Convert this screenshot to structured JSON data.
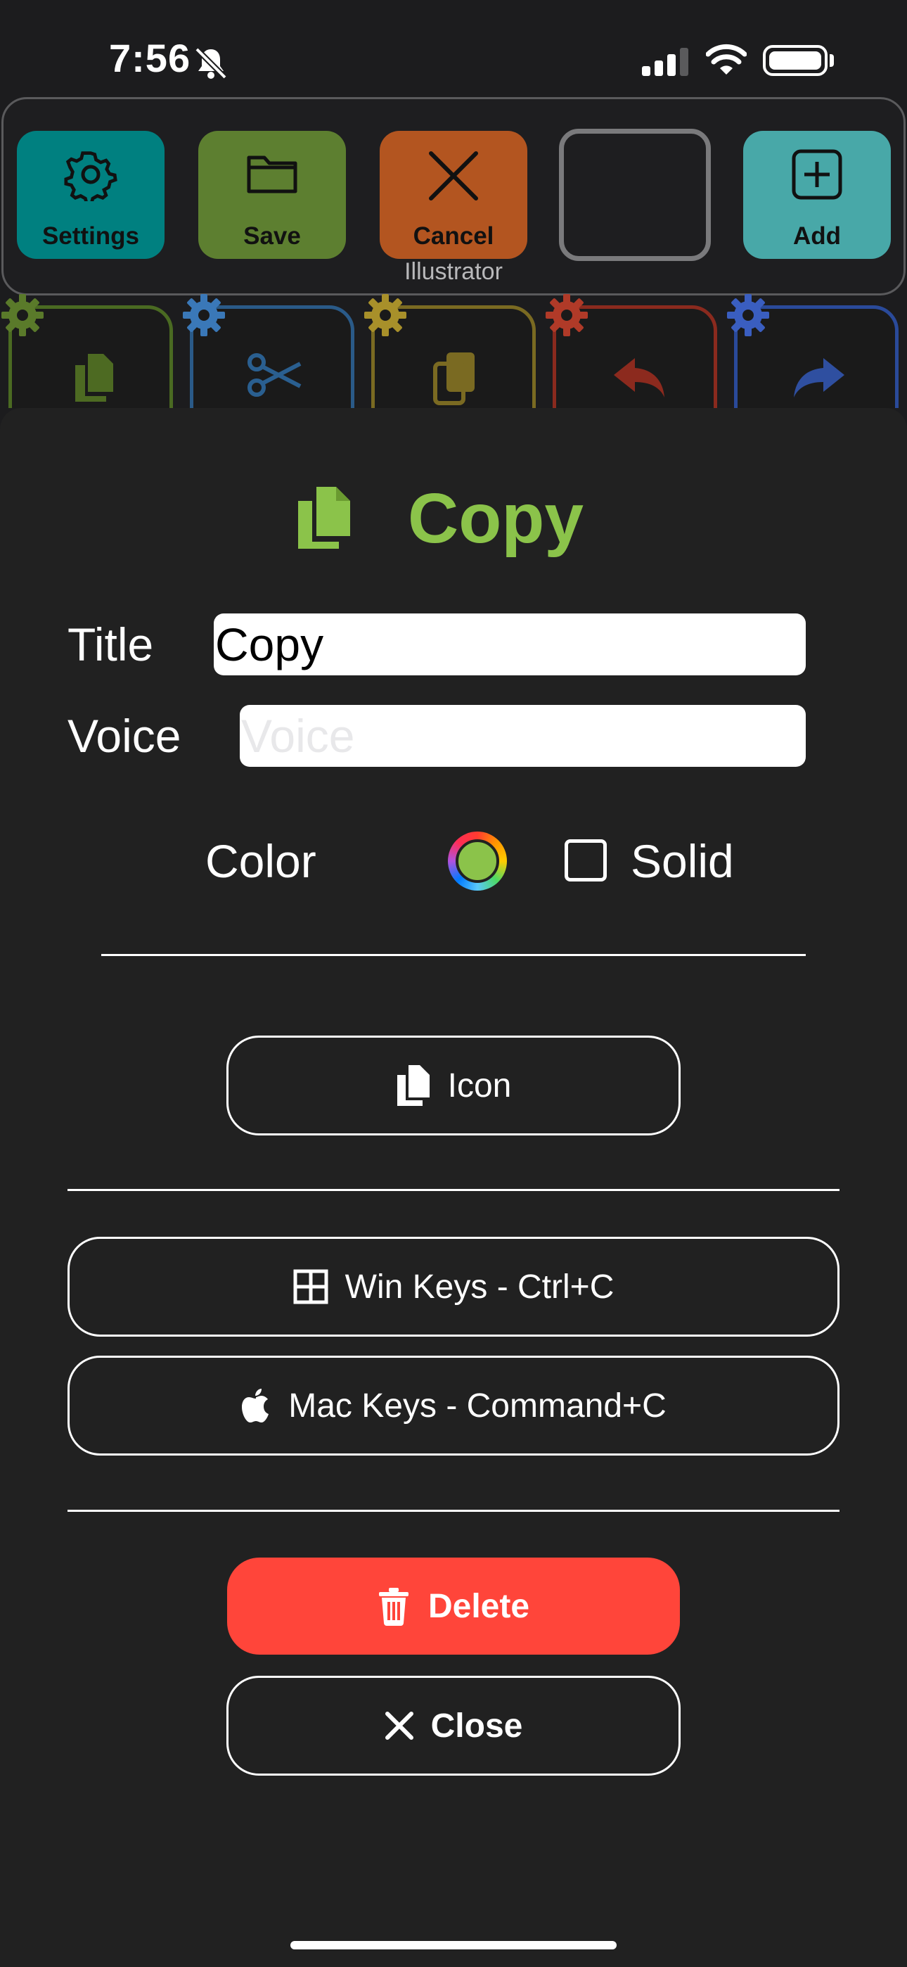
{
  "status_bar": {
    "time": "7:56"
  },
  "toolbar": {
    "buttons": [
      {
        "label": "Settings",
        "icon": "gear-icon",
        "color": "#008080"
      },
      {
        "label": "Save",
        "icon": "folder-icon",
        "color": "#5d7f30"
      },
      {
        "label": "Cancel",
        "icon": "x-icon",
        "color": "#b35520"
      },
      {
        "label": "",
        "icon": "",
        "color": "#1e1e20"
      },
      {
        "label": "Add",
        "icon": "plus-square-icon",
        "color": "#48a8a8"
      }
    ],
    "profile_name": "Illustrator"
  },
  "background_tiles": [
    {
      "icon": "copy-icon",
      "color": "#5a7a2a"
    },
    {
      "icon": "scissors-icon",
      "color": "#2f6fa8"
    },
    {
      "icon": "paste-icon",
      "color": "#8a7a2a"
    },
    {
      "icon": "undo-icon",
      "color": "#9c2f22"
    },
    {
      "icon": "redo-icon",
      "color": "#3358b0"
    }
  ],
  "editor": {
    "header_title": "Copy",
    "title_label": "Title",
    "title_value": "Copy",
    "voice_label": "Voice",
    "voice_placeholder": "Voice",
    "color_label": "Color",
    "selected_color": "#8bc34a",
    "solid_label": "Solid",
    "solid_checked": false,
    "icon_button_label": "Icon",
    "win_keys_label": "Win Keys - Ctrl+C",
    "mac_keys_label": "Mac Keys - Command+C",
    "delete_label": "Delete",
    "close_label": "Close"
  }
}
